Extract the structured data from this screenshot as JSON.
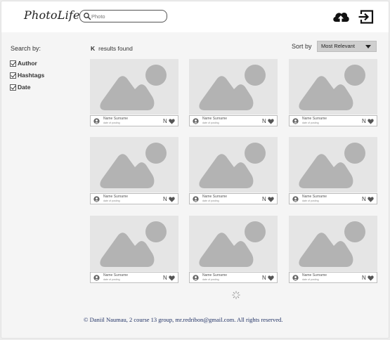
{
  "header": {
    "logo": "PhotoLife",
    "search": {
      "placeholder": "Photo",
      "value": ""
    }
  },
  "sidebar": {
    "title": "Search by:",
    "filters": [
      {
        "label": "Author",
        "checked": true
      },
      {
        "label": "Hashtags",
        "checked": true
      },
      {
        "label": "Date",
        "checked": true
      }
    ]
  },
  "results": {
    "count": "K",
    "label": "results found"
  },
  "sort": {
    "label": "Sort by",
    "selected": "Most Relevant"
  },
  "cards": [
    {
      "name": "Name Surname",
      "date": "date of posting",
      "likes": "N"
    },
    {
      "name": "Name Surname",
      "date": "date of posting",
      "likes": "N"
    },
    {
      "name": "Name Surname",
      "date": "date of posting",
      "likes": "N"
    },
    {
      "name": "Name Surname",
      "date": "date of posting",
      "likes": "N"
    },
    {
      "name": "Name Surname",
      "date": "date of posting",
      "likes": "N"
    },
    {
      "name": "Name Surname",
      "date": "date of posting",
      "likes": "N"
    },
    {
      "name": "Name Surname",
      "date": "date of posting",
      "likes": "N"
    },
    {
      "name": "Name Surname",
      "date": "date of posting",
      "likes": "N"
    },
    {
      "name": "Name Surname",
      "date": "date of posting",
      "likes": "N"
    }
  ],
  "icons": {
    "upload": "cloud-upload-icon",
    "logout": "exit-icon",
    "search": "search-icon",
    "avatar": "user-avatar-icon",
    "like": "heart-icon",
    "loading": "loading-spinner-icon"
  },
  "footer": "© Daniil Naumau, 2 course 13 group, mr.redribon@gmail.com.  All rights reserved."
}
